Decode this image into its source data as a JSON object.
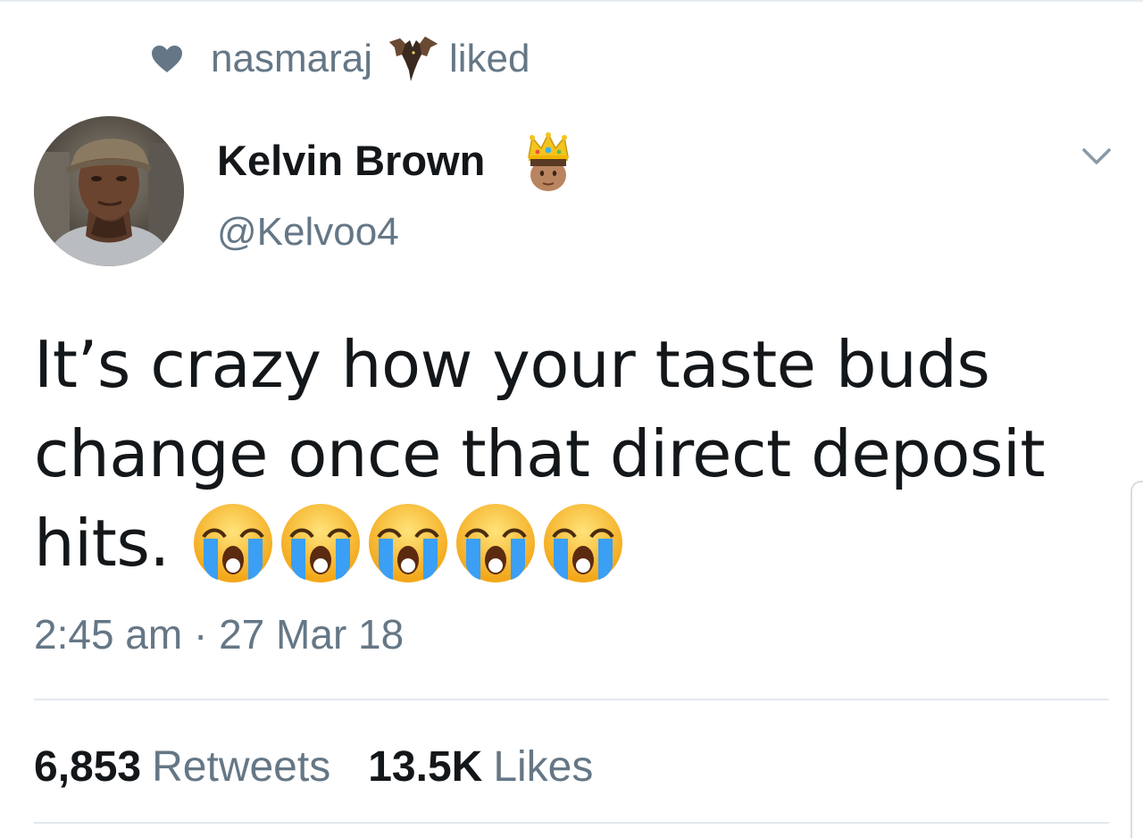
{
  "social_context": {
    "user": "nasmaraj",
    "user_emoji": "bat-icon",
    "action": "liked",
    "icon": "heart-icon"
  },
  "author": {
    "display_name": "Kelvin Brown",
    "name_emoji": "crowned-prince-icon",
    "handle": "@Kelvoo4",
    "avatar": "avatar-photo"
  },
  "menu": {
    "icon": "chevron-down-icon"
  },
  "tweet": {
    "lines": [
      "It’s crazy how your taste buds",
      "change once that direct deposit",
      "hits."
    ],
    "emojis": [
      "loudly-crying-face-icon",
      "loudly-crying-face-icon",
      "loudly-crying-face-icon",
      "loudly-crying-face-icon",
      "loudly-crying-face-icon"
    ]
  },
  "timestamp": "2:45 am · 27 Mar 18",
  "stats": {
    "retweets_count": "6,853",
    "retweets_label": "Retweets",
    "likes_count": "13.5K",
    "likes_label": "Likes"
  },
  "colors": {
    "text_primary": "#14171a",
    "text_secondary": "#657786",
    "divider": "#e1e8ed"
  }
}
